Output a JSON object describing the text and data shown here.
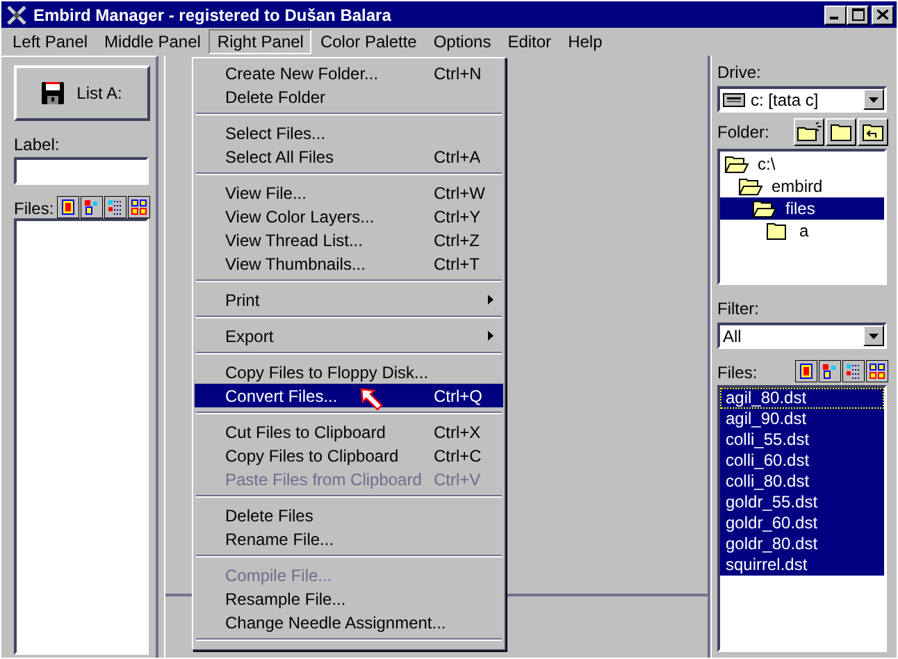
{
  "window": {
    "title": "Embird Manager - registered to Dušan Balara"
  },
  "menu_bar": [
    {
      "label": "Left Panel",
      "selected": false
    },
    {
      "label": "Middle Panel",
      "selected": false
    },
    {
      "label": "Right Panel",
      "selected": true
    },
    {
      "label": "Color Palette",
      "selected": false
    },
    {
      "label": "Options",
      "selected": false
    },
    {
      "label": "Editor",
      "selected": false
    },
    {
      "label": "Help",
      "selected": false
    }
  ],
  "dropdown": [
    {
      "kind": "item",
      "label": "Create New Folder...",
      "shortcut": "Ctrl+N",
      "selected": false,
      "disabled": false
    },
    {
      "kind": "item",
      "label": "Delete Folder",
      "selected": false,
      "disabled": false
    },
    {
      "kind": "separator"
    },
    {
      "kind": "item",
      "label": "Select Files...",
      "selected": false,
      "disabled": false
    },
    {
      "kind": "item",
      "label": "Select All Files",
      "shortcut": "Ctrl+A",
      "selected": false,
      "disabled": false
    },
    {
      "kind": "separator"
    },
    {
      "kind": "item",
      "label": "View File...",
      "shortcut": "Ctrl+W",
      "selected": false,
      "disabled": false
    },
    {
      "kind": "item",
      "label": "View Color Layers...",
      "shortcut": "Ctrl+Y",
      "selected": false,
      "disabled": false
    },
    {
      "kind": "item",
      "label": "View Thread List...",
      "shortcut": "Ctrl+Z",
      "selected": false,
      "disabled": false
    },
    {
      "kind": "item",
      "label": "View Thumbnails...",
      "shortcut": "Ctrl+T",
      "selected": false,
      "disabled": false
    },
    {
      "kind": "separator"
    },
    {
      "kind": "submenu",
      "label": "Print",
      "selected": false,
      "disabled": false
    },
    {
      "kind": "separator"
    },
    {
      "kind": "submenu",
      "label": "Export",
      "selected": false,
      "disabled": false
    },
    {
      "kind": "separator"
    },
    {
      "kind": "item",
      "label": "Copy Files to Floppy Disk...",
      "selected": false,
      "disabled": false
    },
    {
      "kind": "item",
      "label": "Convert Files...",
      "shortcut": "Ctrl+Q",
      "selected": true,
      "disabled": false
    },
    {
      "kind": "separator"
    },
    {
      "kind": "item",
      "label": "Cut Files to Clipboard",
      "shortcut": "Ctrl+X",
      "selected": false,
      "disabled": false
    },
    {
      "kind": "item",
      "label": "Copy Files to Clipboard",
      "shortcut": "Ctrl+C",
      "selected": false,
      "disabled": false
    },
    {
      "kind": "item",
      "label": "Paste Files from Clipboard",
      "shortcut": "Ctrl+V",
      "selected": false,
      "disabled": true
    },
    {
      "kind": "separator"
    },
    {
      "kind": "item",
      "label": "Delete Files",
      "selected": false,
      "disabled": false
    },
    {
      "kind": "item",
      "label": "Rename File...",
      "selected": false,
      "disabled": false
    },
    {
      "kind": "separator"
    },
    {
      "kind": "item",
      "label": "Compile File...",
      "selected": false,
      "disabled": true
    },
    {
      "kind": "item",
      "label": "Resample File...",
      "selected": false,
      "disabled": false
    },
    {
      "kind": "item",
      "label": "Change Needle Assignment...",
      "selected": false,
      "disabled": false
    },
    {
      "kind": "separator"
    }
  ],
  "left_panel": {
    "list_button": "List A:",
    "label_caption": "Label:",
    "files_caption": "Files:"
  },
  "right_panel": {
    "drive_caption": "Drive:",
    "drive": "c: [tata c]",
    "folder_caption": "Folder:",
    "folders": [
      {
        "label": "c:\\",
        "selected": false,
        "children": [
          {
            "label": "embird",
            "selected": false,
            "children": [
              {
                "label": "files",
                "selected": true,
                "children": [
                  {
                    "label": "a",
                    "selected": false
                  }
                ]
              }
            ]
          }
        ]
      }
    ],
    "filter_caption": "Filter:",
    "filter": "All",
    "files_caption": "Files:",
    "files": [
      {
        "name": "agil_80.dst",
        "selected": true,
        "focused": true
      },
      {
        "name": "agil_90.dst",
        "selected": true,
        "focused": false
      },
      {
        "name": "colli_55.dst",
        "selected": true,
        "focused": false
      },
      {
        "name": "colli_60.dst",
        "selected": true,
        "focused": false
      },
      {
        "name": "colli_80.dst",
        "selected": true,
        "focused": false
      },
      {
        "name": "goldr_55.dst",
        "selected": true,
        "focused": false
      },
      {
        "name": "goldr_60.dst",
        "selected": true,
        "focused": false
      },
      {
        "name": "goldr_80.dst",
        "selected": true,
        "focused": false
      },
      {
        "name": "squirrel.dst",
        "selected": true,
        "focused": false
      }
    ]
  }
}
